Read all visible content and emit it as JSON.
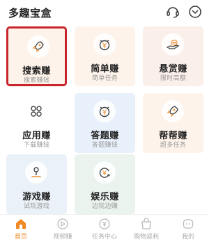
{
  "header": {
    "title": "多趣宝盒",
    "support_icon": "headset-icon",
    "more_icon": "chevron-down-circle-icon"
  },
  "tiles": [
    {
      "title": "搜索赚",
      "subtitle": "搜索赚钱",
      "icon": "rocket-icon",
      "color": "#fdf3ea",
      "selected": true
    },
    {
      "title": "简单赚",
      "subtitle": "简单任务",
      "icon": "yen-clock-icon",
      "color": "#fdf3ea"
    },
    {
      "title": "悬赏赚",
      "subtitle": "限时高额",
      "icon": "coin-hand-icon",
      "color": "#fbefea"
    },
    {
      "title": "应用赚",
      "subtitle": "下载赚钱",
      "icon": "apps-icon",
      "color": "#ffffff"
    },
    {
      "title": "答题赚",
      "subtitle": "答题赚钱",
      "icon": "yen-clock-icon",
      "color": "#e8f1fb"
    },
    {
      "title": "帮帮赚",
      "subtitle": "超多任务",
      "icon": "rocket-icon",
      "color": "#fdf3ea"
    },
    {
      "title": "游戏赚",
      "subtitle": "试玩游戏",
      "icon": "joystick-icon",
      "color": "#eaf1f8"
    },
    {
      "title": "娱乐赚",
      "subtitle": "边玩边赚",
      "icon": "yen-refresh-icon",
      "color": "#eaf3ee"
    }
  ],
  "tabbar": {
    "active": "首页",
    "items": [
      {
        "label": "首页",
        "icon": "home-icon"
      },
      {
        "label": "视频赚",
        "icon": "play-icon"
      },
      {
        "label": "任务中心",
        "icon": "task-icon"
      },
      {
        "label": "购物返利",
        "icon": "shop-icon"
      },
      {
        "label": "我的",
        "icon": "profile-icon"
      }
    ]
  },
  "colors": {
    "accent": "#f08a24",
    "selection_border": "#c9232b",
    "icon_orange": "#f0a050",
    "icon_dark": "#444444"
  }
}
